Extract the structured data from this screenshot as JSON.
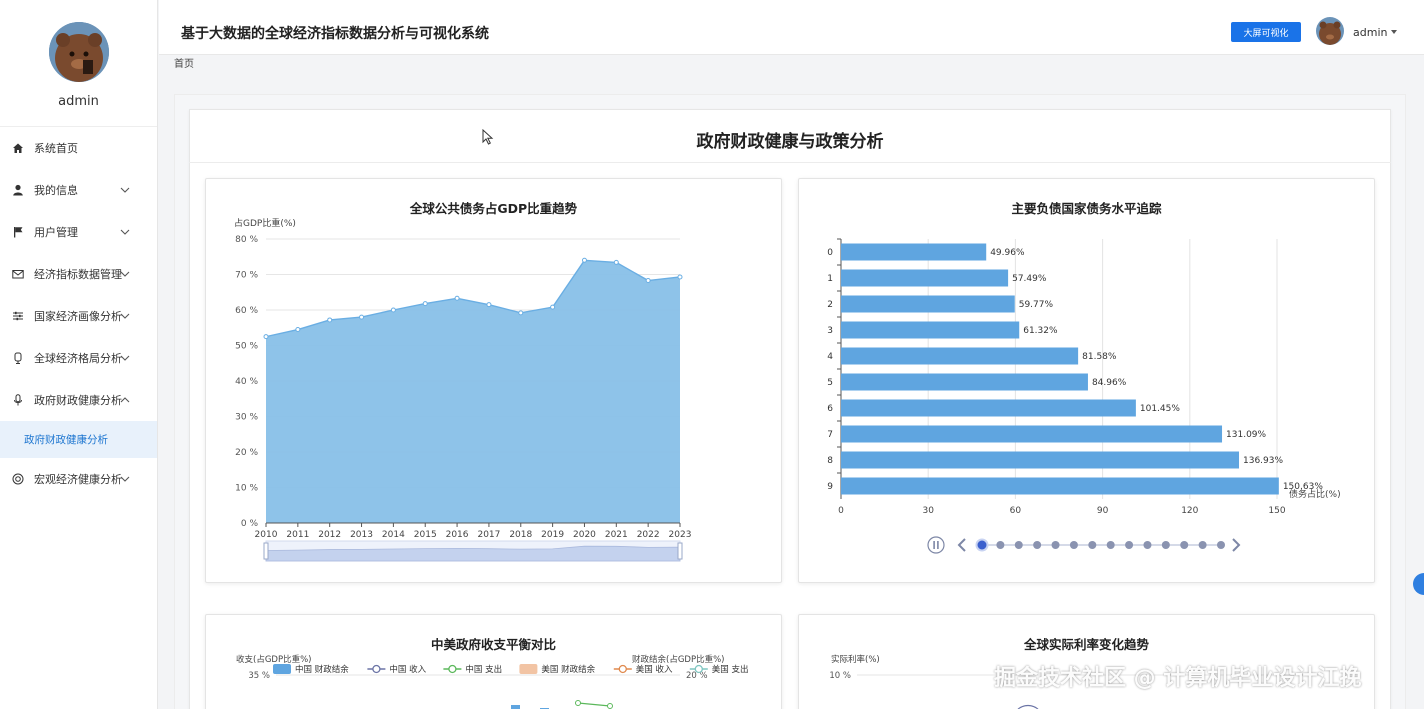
{
  "app": {
    "title": "基于大数据的全球经济指标数据分析与可视化系统"
  },
  "header": {
    "bigscreen_button": "大屏可视化",
    "user": "admin"
  },
  "breadcrumb": "首页",
  "sidebar": {
    "user": "admin",
    "items": [
      {
        "label": "系统首页",
        "icon": "home-icon",
        "arrow": "none"
      },
      {
        "label": "我的信息",
        "icon": "user-icon",
        "arrow": "down"
      },
      {
        "label": "用户管理",
        "icon": "flag-icon",
        "arrow": "down"
      },
      {
        "label": "经济指标数据管理",
        "icon": "mail-icon",
        "arrow": "down"
      },
      {
        "label": "国家经济画像分析",
        "icon": "sliders-icon",
        "arrow": "down"
      },
      {
        "label": "全球经济格局分析",
        "icon": "badge-icon",
        "arrow": "down"
      },
      {
        "label": "政府财政健康分析",
        "icon": "mic-icon",
        "arrow": "up"
      },
      {
        "label": "宏观经济健康分析",
        "icon": "target-icon",
        "arrow": "down"
      }
    ],
    "active_sub": "政府财政健康分析"
  },
  "page": {
    "title": "政府财政健康与政策分析"
  },
  "colors": {
    "primary": "#1a73e8",
    "bar": "#5fa5e0",
    "area": "#88c0e8",
    "line": "#6aaee3"
  },
  "chart_data": [
    {
      "type": "area",
      "title": "全球公共债务占GDP比重趋势",
      "ylabel": "占GDP比重(%)",
      "x": [
        "2010",
        "2011",
        "2012",
        "2013",
        "2014",
        "2015",
        "2016",
        "2017",
        "2018",
        "2019",
        "2020",
        "2021",
        "2022",
        "2023"
      ],
      "values": [
        52.5,
        54.5,
        57.2,
        58.0,
        60.0,
        61.8,
        63.3,
        61.5,
        59.2,
        60.8,
        74.0,
        73.4,
        68.3,
        69.3
      ],
      "yticks": [
        "0 %",
        "10 %",
        "20 %",
        "30 %",
        "40 %",
        "50 %",
        "60 %",
        "70 %",
        "80 %"
      ],
      "ylim": [
        0,
        80
      ],
      "grid": true,
      "datazoom": true
    },
    {
      "type": "bar",
      "orientation": "horizontal",
      "title": "主要负债国家债务水平追踪",
      "xlabel": "债务占比(%)",
      "categories": [
        "0",
        "1",
        "2",
        "3",
        "4",
        "5",
        "6",
        "7",
        "8",
        "9"
      ],
      "values": [
        49.96,
        57.49,
        59.77,
        61.32,
        81.58,
        84.96,
        101.45,
        131.09,
        136.93,
        150.63
      ],
      "labels": [
        "49.96%",
        "57.49%",
        "59.77%",
        "61.32%",
        "81.58%",
        "84.96%",
        "101.45%",
        "131.09%",
        "136.93%",
        "150.63%"
      ],
      "xticks": [
        "0",
        "30",
        "60",
        "90",
        "120",
        "150"
      ],
      "xlim": [
        0,
        150
      ],
      "timeline": {
        "points": 14,
        "active": 0
      }
    },
    {
      "type": "bar",
      "title": "中美政府收支平衡对比",
      "ylabel": "收支(占GDP比重%)",
      "ylabel_right": "财政结余(占GDP比重%)",
      "ytick_top": "35 %",
      "ytick_right_top": "20 %",
      "legend": [
        "中国 财政结余",
        "中国 收入",
        "中国 支出",
        "美国 财政结余",
        "美国 收入",
        "美国 支出"
      ]
    },
    {
      "type": "line",
      "title": "全球实际利率变化趋势",
      "ylabel": "实际利率(%)",
      "ytick_top": "10 %"
    }
  ],
  "watermark": "掘金技术社区 @ 计算机毕业设计江挽"
}
